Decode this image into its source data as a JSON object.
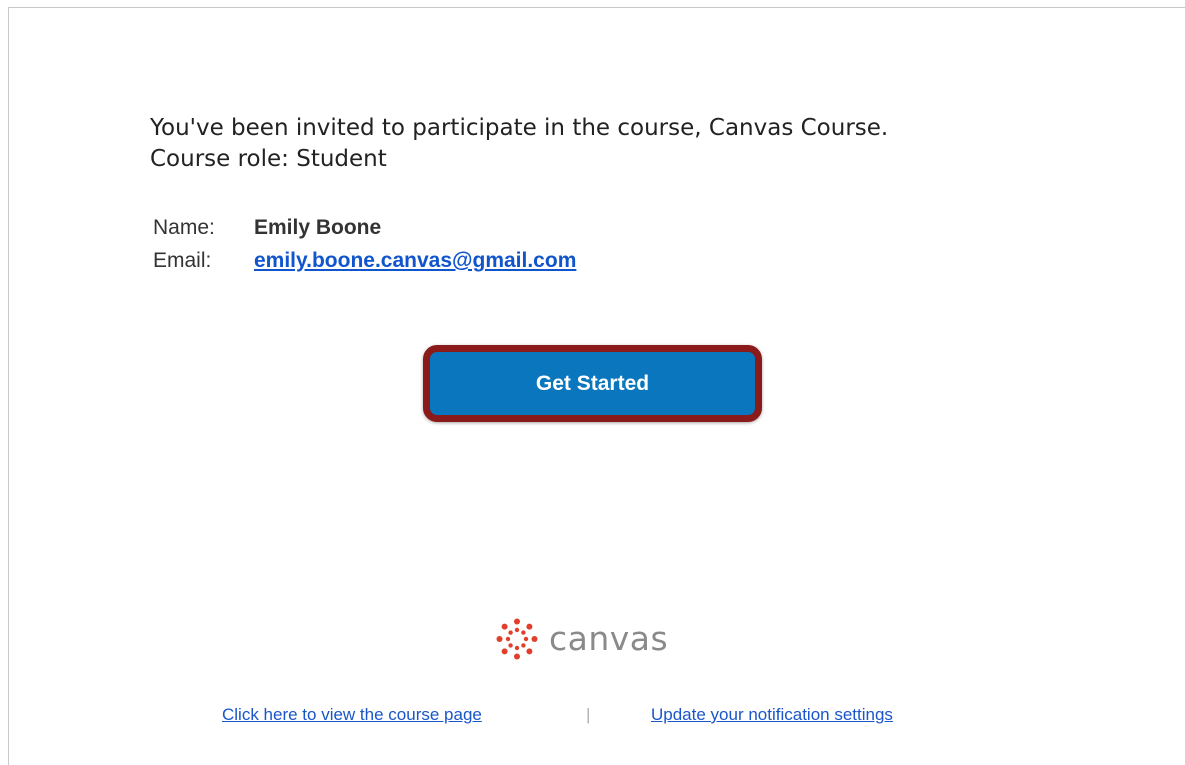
{
  "invitation": {
    "line1": "You've been invited to participate in the course, Canvas Course.",
    "line2": "Course role: Student"
  },
  "details": {
    "name_label": "Name:",
    "name_value": "Emily Boone",
    "email_label": "Email:",
    "email_value": "emily.boone.canvas@gmail.com"
  },
  "cta": {
    "label": "Get Started",
    "color": "#0a76be",
    "highlight_border_color": "#8b1a1a"
  },
  "logo": {
    "icon": "canvas-logo-icon",
    "text": "canvas",
    "color": "#e13f2b"
  },
  "footer": {
    "course_link": "Click here to view the course page",
    "separator": "|",
    "settings_link": "Update your notification settings"
  }
}
